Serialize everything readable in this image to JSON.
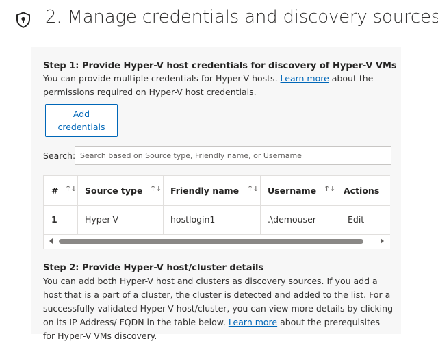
{
  "header": {
    "title": "2. Manage credentials and discovery sources",
    "icon": "shield-lock-icon"
  },
  "step1": {
    "heading": "Step 1: Provide Hyper-V host credentials for discovery of Hyper-V VMs",
    "text_before_link": "You can provide multiple credentials for Hyper-V hosts. ",
    "link": "Learn more",
    "text_after_link": " about the permissions required on Hyper-V host credentials.",
    "add_button": {
      "line1": "Add",
      "line2": "credentials"
    }
  },
  "search": {
    "label": "Search:",
    "placeholder": "Search based on Source type, Friendly name, or Username",
    "value": ""
  },
  "table": {
    "columns": [
      "#",
      "Source type",
      "Friendly name",
      "Username",
      "Actions"
    ],
    "sort_icon": "↑↓",
    "rows": [
      {
        "num": "1",
        "source_type": "Hyper-V",
        "friendly_name": "hostlogin1",
        "username": ".\\demouser",
        "action": "Edit"
      }
    ]
  },
  "step2": {
    "heading": "Step 2: Provide Hyper-V host/cluster details",
    "text_before_link": "You can add both Hyper-V host and clusters as discovery sources. If you add a host that is a part of a cluster, the cluster is detected and added to the list. For a successfully validated Hyper-V host/cluster, you can view more details by clicking on its IP Address/ FQDN in the table below. ",
    "link": "Learn more",
    "text_after_link": " about the prerequisites for Hyper-V VMs discovery."
  },
  "colors": {
    "accent": "#0067b8",
    "panel_bg": "#f7f7f7",
    "border": "#e1dfdd"
  }
}
